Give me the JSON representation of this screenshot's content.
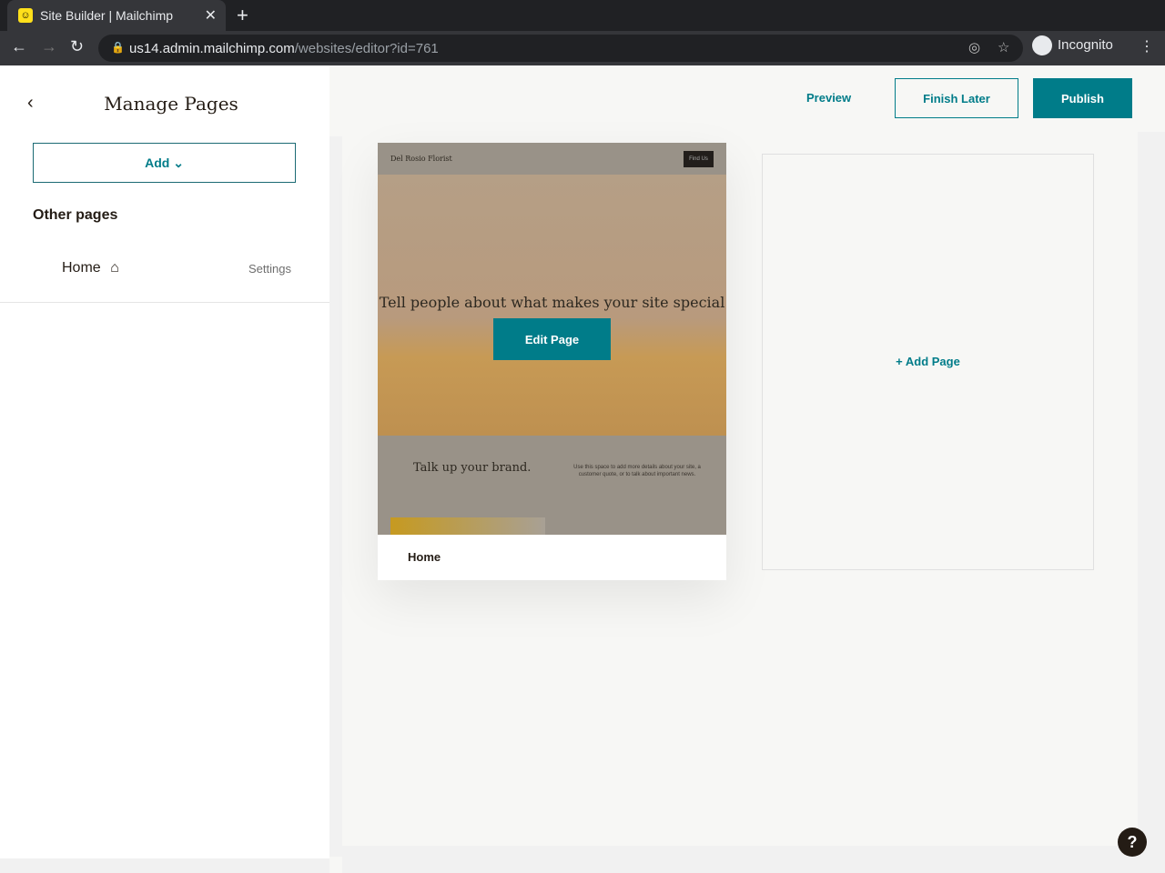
{
  "browser": {
    "tab_title": "Site Builder | Mailchimp",
    "url_host": "us14.admin.mailchimp.com",
    "url_path": "/websites/editor?id=761",
    "profile": "Incognito"
  },
  "sidebar": {
    "title": "Manage Pages",
    "add_label": "Add",
    "section": "Other pages",
    "pages": [
      {
        "name": "Home",
        "settings": "Settings"
      }
    ]
  },
  "toolbar": {
    "preview": "Preview",
    "finish_later": "Finish Later",
    "publish": "Publish"
  },
  "canvas": {
    "page_card": {
      "label": "Home",
      "edit": "Edit Page",
      "thumb": {
        "brand": "Del Rosio Florist",
        "cta": "Find Us",
        "hero": "Tell people about what makes your site special",
        "section_title": "Talk up your brand.",
        "section_body": "Use this space to add more details about your site, a customer quote, or to talk about important news."
      }
    },
    "add_page": "Add Page"
  },
  "help": "?",
  "colors": {
    "accent": "#007c89"
  }
}
